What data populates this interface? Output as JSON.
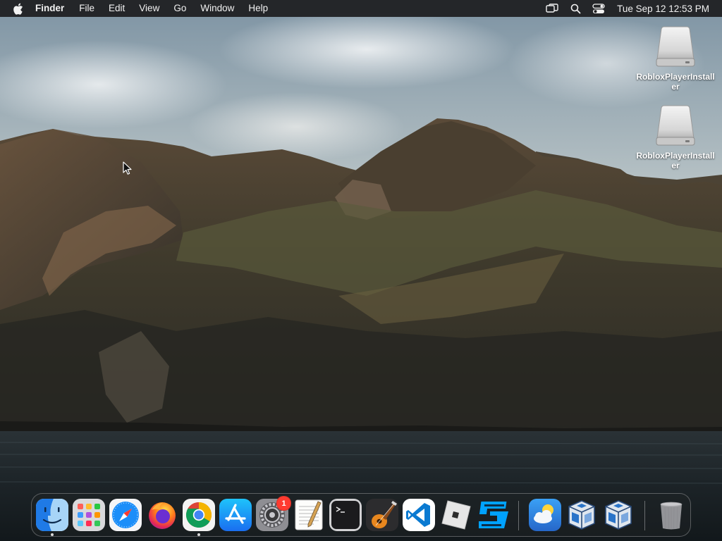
{
  "menubar": {
    "app_name": "Finder",
    "items": [
      {
        "label": "File"
      },
      {
        "label": "Edit"
      },
      {
        "label": "View"
      },
      {
        "label": "Go"
      },
      {
        "label": "Window"
      },
      {
        "label": "Help"
      }
    ],
    "status_icons": [
      "screen-mirroring-icon",
      "spotlight-search-icon",
      "control-center-icon"
    ],
    "clock": "Tue Sep 12  12:53 PM"
  },
  "desktop": {
    "icons": [
      {
        "label": "RobloxPlayerInstaller",
        "icon": "disk-image-icon"
      },
      {
        "label": "RobloxPlayerInstaller",
        "icon": "disk-image-icon"
      }
    ]
  },
  "dock": {
    "apps": [
      {
        "icon": "finder-icon",
        "running": true
      },
      {
        "icon": "launchpad-icon",
        "running": false
      },
      {
        "icon": "safari-icon",
        "running": false
      },
      {
        "icon": "firefox-icon",
        "running": false
      },
      {
        "icon": "chrome-icon",
        "running": true
      },
      {
        "icon": "app-store-icon",
        "running": false
      },
      {
        "icon": "system-settings-icon",
        "running": false,
        "badge": "1"
      },
      {
        "icon": "textedit-icon",
        "running": false
      },
      {
        "icon": "terminal-icon",
        "running": false
      },
      {
        "icon": "garageband-icon",
        "running": false
      },
      {
        "icon": "vscode-icon",
        "running": false
      },
      {
        "icon": "roblox-icon",
        "running": false
      },
      {
        "icon": "roblox-studio-icon",
        "running": false
      },
      {
        "icon": "weather-icon",
        "running": false
      },
      {
        "icon": "virtualbox-icon",
        "running": false
      },
      {
        "icon": "virtualbox-icon",
        "running": false
      },
      {
        "icon": "trash-icon",
        "running": false
      }
    ]
  },
  "colors": {
    "menubar_bg": "#1c1c1e",
    "badge": "#ff3b30",
    "vscode_blue": "#0a7ad1",
    "roblox_studio_blue": "#00a2ff"
  }
}
